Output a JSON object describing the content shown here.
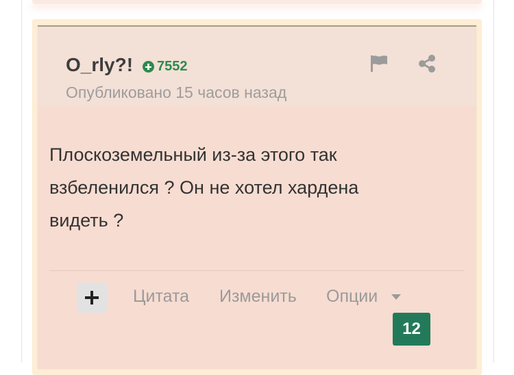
{
  "post": {
    "author": "O_rly?!",
    "reputation": "7552",
    "published": "Опубликовано 15 часов назад",
    "body_lines": [
      "Плоскоземельный из-за этого так",
      "взбеленился ? Он не хотел хардена",
      "видеть ?"
    ]
  },
  "actions": {
    "quote": "Цитата",
    "edit": "Изменить",
    "options": "Опции"
  },
  "badge": {
    "count": "12"
  },
  "icons": {
    "flag": "flag-icon",
    "share": "share-icon",
    "reputation": "plus-circle-icon",
    "plus": "plus-icon",
    "caret": "caret-down-icon"
  },
  "colors": {
    "reputation_green": "#2d8a4f",
    "badge_green": "#237a5a",
    "card_background": "#f7dcd1",
    "highlight_border": "#fdeed5"
  }
}
